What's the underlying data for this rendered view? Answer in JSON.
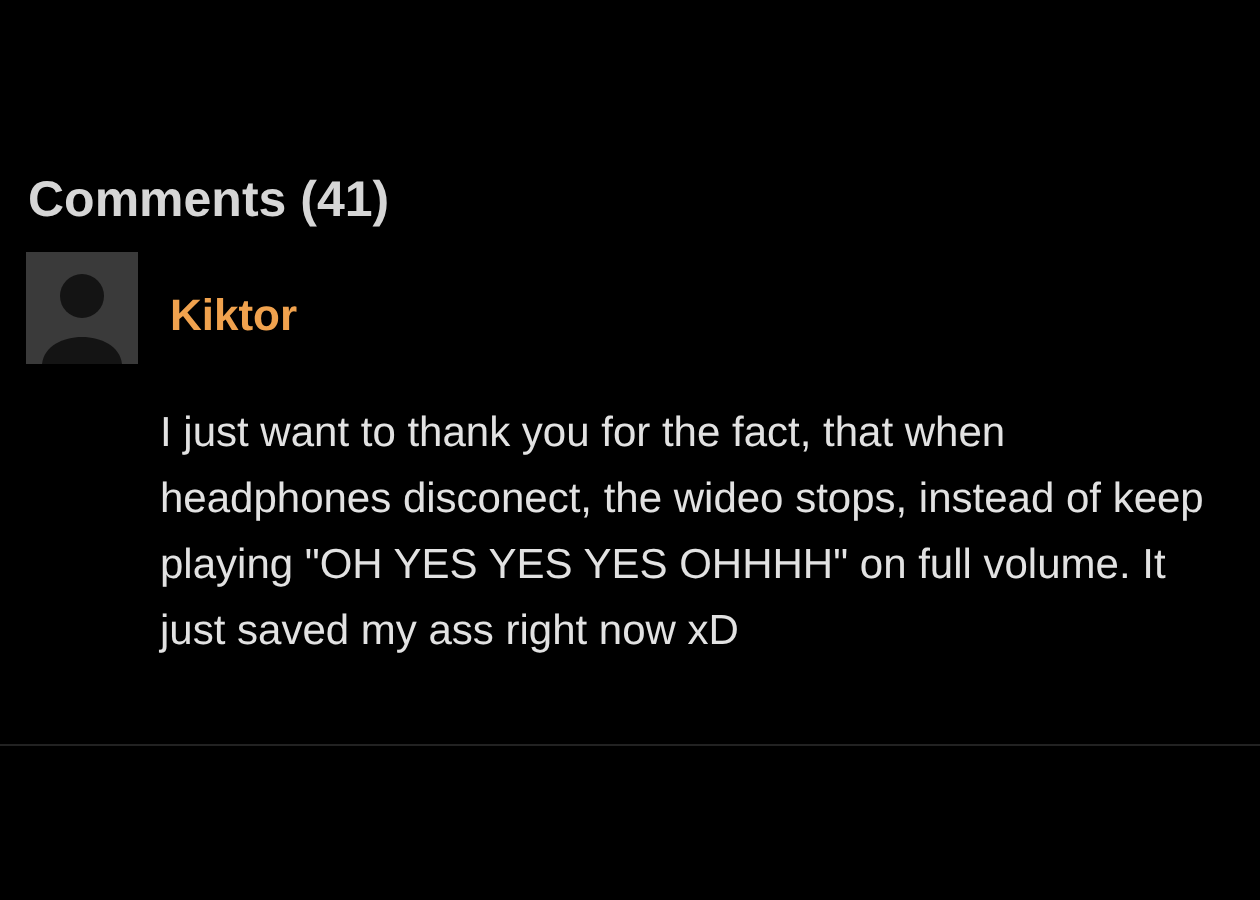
{
  "comments_section": {
    "title": "Comments (41)",
    "comments": [
      {
        "author": "Kiktor",
        "text": "I just want to thank you for the fact, that when headphones disconect, the wideo stops, instead of keep playing \"OH YES YES YES OHHHH\" on full volume. It just saved my ass right now xD"
      }
    ]
  }
}
